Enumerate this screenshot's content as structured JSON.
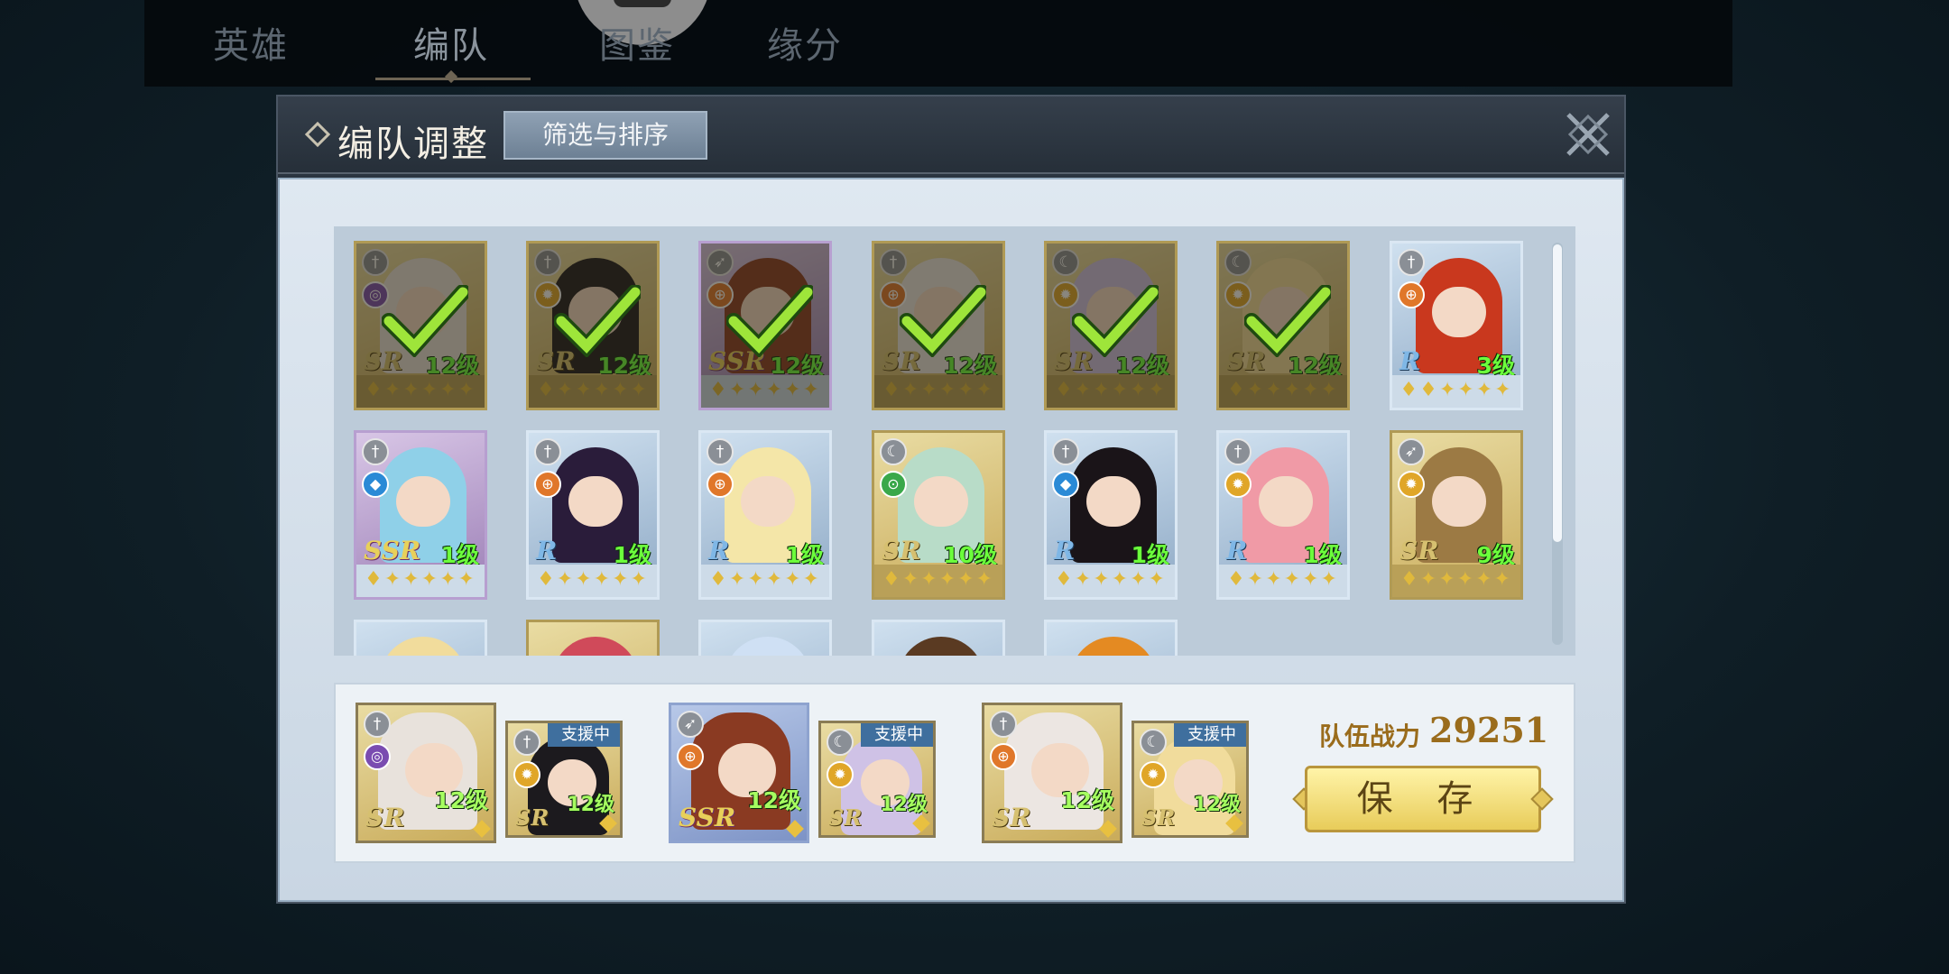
{
  "top_tabs": [
    {
      "label": "英雄",
      "active": false
    },
    {
      "label": "编队",
      "active": true
    },
    {
      "label": "图鉴",
      "active": false
    },
    {
      "label": "缘分",
      "active": false
    }
  ],
  "panel": {
    "title": "编队调整",
    "filter_button": "筛选与排序",
    "close_icon": "close-x-icon"
  },
  "roster": {
    "row1": [
      {
        "rarity": "SR",
        "level": "12级",
        "selected": true,
        "class_icon": "sword-icon",
        "element_icon": "dark-icon",
        "frame": "gold",
        "hair": "#e8e2dc",
        "stars": "♦✦✦✦✦✦"
      },
      {
        "rarity": "SR",
        "level": "12级",
        "selected": true,
        "class_icon": "sword-icon",
        "element_icon": "light-icon",
        "frame": "gold",
        "hair": "#1c1a1e",
        "stars": "♦✦✦✦✦✦"
      },
      {
        "rarity": "SSR",
        "level": "12级",
        "selected": true,
        "class_icon": "bow-icon",
        "element_icon": "fire-icon",
        "frame": "purple",
        "hair": "#8a3a22",
        "stars": "♦✦✦✦✦✦"
      },
      {
        "rarity": "SR",
        "level": "12级",
        "selected": true,
        "class_icon": "sword-icon",
        "element_icon": "fire-icon",
        "frame": "gold",
        "hair": "#ece6e2",
        "stars": "♦✦✦✦✦✦"
      },
      {
        "rarity": "SR",
        "level": "12级",
        "selected": true,
        "class_icon": "moon-icon",
        "element_icon": "light-icon",
        "frame": "gold",
        "hair": "#cfc2e6",
        "stars": "♦✦✦✦✦✦"
      },
      {
        "rarity": "SR",
        "level": "12级",
        "selected": true,
        "class_icon": "moon-icon",
        "element_icon": "light-icon",
        "frame": "gold",
        "hair": "#f1dc9c",
        "stars": "♦✦✦✦✦✦"
      },
      {
        "rarity": "R",
        "level": "3级",
        "selected": false,
        "class_icon": "sword-icon",
        "element_icon": "fire-icon",
        "frame": "blue",
        "hair": "#c9381e",
        "stars": "♦♦✦✦✦✦"
      }
    ],
    "row2": [
      {
        "rarity": "SSR",
        "level": "1级",
        "selected": false,
        "class_icon": "sword-icon",
        "element_icon": "water-icon",
        "frame": "purple",
        "hair": "#8fd0e8",
        "stars": "♦✦✦✦✦✦"
      },
      {
        "rarity": "R",
        "level": "1级",
        "selected": false,
        "class_icon": "sword-icon",
        "element_icon": "fire-icon",
        "frame": "blue",
        "hair": "#2a1c3a",
        "stars": "♦✦✦✦✦✦"
      },
      {
        "rarity": "R",
        "level": "1级",
        "selected": false,
        "class_icon": "sword-icon",
        "element_icon": "fire-icon",
        "frame": "blue",
        "hair": "#f4e6a8",
        "stars": "♦✦✦✦✦✦"
      },
      {
        "rarity": "SR",
        "level": "10级",
        "selected": false,
        "class_icon": "moon-icon",
        "element_icon": "wind-icon",
        "frame": "gold",
        "hair": "#b8dcc8",
        "stars": "♦✦✦✦✦✦"
      },
      {
        "rarity": "R",
        "level": "1级",
        "selected": false,
        "class_icon": "sword-icon",
        "element_icon": "water-icon",
        "frame": "blue",
        "hair": "#1a1418",
        "stars": "♦✦✦✦✦✦"
      },
      {
        "rarity": "R",
        "level": "1级",
        "selected": false,
        "class_icon": "sword-icon",
        "element_icon": "light-icon",
        "frame": "blue",
        "hair": "#f09aa6",
        "stars": "♦✦✦✦✦✦"
      },
      {
        "rarity": "SR",
        "level": "9级",
        "selected": false,
        "class_icon": "bow-icon",
        "element_icon": "light-icon",
        "frame": "gold",
        "hair": "#9c7a44",
        "stars": "♦✦✦✦✦✦"
      }
    ]
  },
  "team": {
    "slots": [
      {
        "main": {
          "rarity": "SR",
          "level": "12级",
          "class_icon": "sword-icon",
          "element_icon": "dark-icon",
          "hair": "#e8e2dc"
        },
        "support": {
          "tag": "支援中",
          "rarity": "SR",
          "level": "12级",
          "class_icon": "sword-icon",
          "element_icon": "light-icon",
          "hair": "#1c1a1e"
        }
      },
      {
        "main": {
          "rarity": "SSR",
          "level": "12级",
          "class_icon": "bow-icon",
          "element_icon": "fire-icon",
          "hair": "#8a3a22"
        },
        "support": {
          "tag": "支援中",
          "rarity": "SR",
          "level": "12级",
          "class_icon": "moon-icon",
          "element_icon": "light-icon",
          "hair": "#cfc2e6"
        }
      },
      {
        "main": {
          "rarity": "SR",
          "level": "12级",
          "class_icon": "sword-icon",
          "element_icon": "fire-icon",
          "hair": "#ece6e2"
        },
        "support": {
          "tag": "支援中",
          "rarity": "SR",
          "level": "12级",
          "class_icon": "moon-icon",
          "element_icon": "light-icon",
          "hair": "#f1dc9c"
        }
      }
    ],
    "power_label": "队伍战力",
    "power_value": "29251",
    "save_button": "保 存"
  }
}
